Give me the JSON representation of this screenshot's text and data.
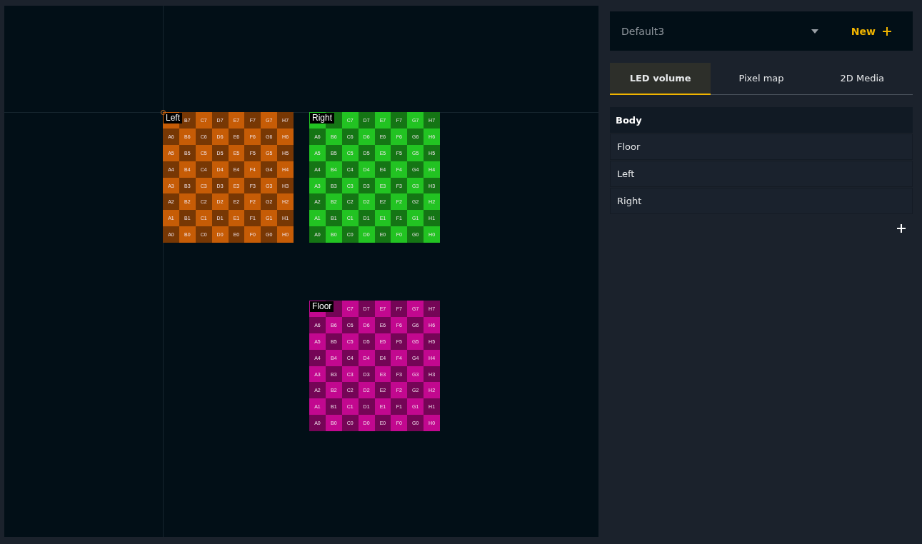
{
  "canvas": {
    "panels": [
      {
        "label": "Left",
        "color": "#c65c06",
        "rows": [
          [
            "",
            "B7",
            "C7",
            "D7",
            "E7",
            "F7",
            "G7",
            "H7"
          ],
          [
            "A6",
            "B6",
            "C6",
            "D6",
            "E6",
            "F6",
            "G6",
            "H6"
          ],
          [
            "A5",
            "B5",
            "C5",
            "D5",
            "E5",
            "F5",
            "G5",
            "H5"
          ],
          [
            "A4",
            "B4",
            "C4",
            "D4",
            "E4",
            "F4",
            "G4",
            "H4"
          ],
          [
            "A3",
            "B3",
            "C3",
            "D3",
            "E3",
            "F3",
            "G3",
            "H3"
          ],
          [
            "A2",
            "B2",
            "C2",
            "D2",
            "E2",
            "F2",
            "G2",
            "H2"
          ],
          [
            "A1",
            "B1",
            "C1",
            "D1",
            "E1",
            "F1",
            "G1",
            "H1"
          ],
          [
            "A0",
            "B0",
            "C0",
            "D0",
            "E0",
            "F0",
            "G0",
            "H0"
          ]
        ]
      },
      {
        "label": "Right",
        "color": "#22c322",
        "rows": [
          [
            "",
            "",
            "C7",
            "D7",
            "E7",
            "F7",
            "G7",
            "H7"
          ],
          [
            "A6",
            "B6",
            "C6",
            "D6",
            "E6",
            "F6",
            "G6",
            "H6"
          ],
          [
            "A5",
            "B5",
            "C5",
            "D5",
            "E5",
            "F5",
            "G5",
            "H5"
          ],
          [
            "A4",
            "B4",
            "C4",
            "D4",
            "E4",
            "F4",
            "G4",
            "H4"
          ],
          [
            "A3",
            "B3",
            "C3",
            "D3",
            "E3",
            "F3",
            "G3",
            "H3"
          ],
          [
            "A2",
            "B2",
            "C2",
            "D2",
            "E2",
            "F2",
            "G2",
            "H2"
          ],
          [
            "A1",
            "B1",
            "C1",
            "D1",
            "E1",
            "F1",
            "G1",
            "H1"
          ],
          [
            "A0",
            "B0",
            "C0",
            "D0",
            "E0",
            "F0",
            "G0",
            "H0"
          ]
        ]
      },
      {
        "label": "Floor",
        "color": "#c2088f",
        "rows": [
          [
            "",
            "",
            "C7",
            "D7",
            "E7",
            "F7",
            "G7",
            "H7"
          ],
          [
            "A6",
            "B6",
            "C6",
            "D6",
            "E6",
            "F6",
            "G6",
            "H6"
          ],
          [
            "A5",
            "B5",
            "C5",
            "D5",
            "E5",
            "F5",
            "G5",
            "H5"
          ],
          [
            "A4",
            "B4",
            "C4",
            "D4",
            "E4",
            "F4",
            "G4",
            "H4"
          ],
          [
            "A3",
            "B3",
            "C3",
            "D3",
            "E3",
            "F3",
            "G3",
            "H3"
          ],
          [
            "A2",
            "B2",
            "C2",
            "D2",
            "E2",
            "F2",
            "G2",
            "H2"
          ],
          [
            "A1",
            "B1",
            "C1",
            "D1",
            "E1",
            "F1",
            "G1",
            "H1"
          ],
          [
            "A0",
            "B0",
            "C0",
            "D0",
            "E0",
            "F0",
            "G0",
            "H0"
          ]
        ]
      }
    ]
  },
  "preset": {
    "value": "Default3",
    "new_button": "New"
  },
  "tabs": [
    {
      "label": "LED volume",
      "selected": true
    },
    {
      "label": "Pixel map",
      "selected": false
    },
    {
      "label": "2D Media",
      "selected": false
    }
  ],
  "list": {
    "header": "Body",
    "items": [
      "Floor",
      "Left",
      "Right"
    ]
  }
}
